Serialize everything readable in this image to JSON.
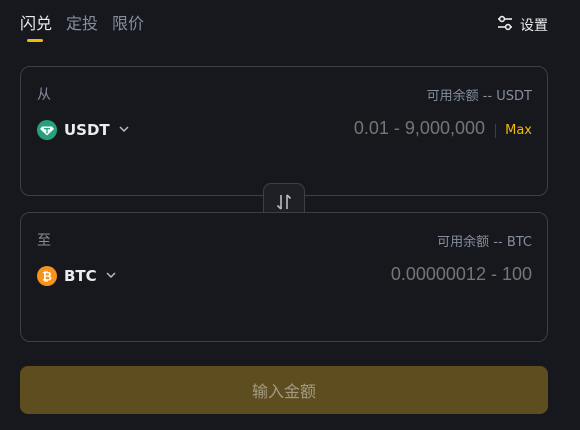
{
  "tabs": [
    {
      "label": "闪兑",
      "active": true
    },
    {
      "label": "定投",
      "active": false
    },
    {
      "label": "限价",
      "active": false
    }
  ],
  "settings": {
    "label": "设置",
    "icon": "sliders-icon"
  },
  "from": {
    "label": "从",
    "available": "可用余额 -- USDT",
    "asset": "USDT",
    "asset_icon": "usdt-coin-icon",
    "placeholder": "0.01 - 9,000,000",
    "max_label": "Max"
  },
  "to": {
    "label": "至",
    "available": "可用余额 -- BTC",
    "asset": "BTC",
    "asset_icon": "btc-coin-icon",
    "placeholder": "0.00000012 - 100"
  },
  "swap_icon": "swap-vertical-icon",
  "cta": {
    "label": "输入金额"
  },
  "colors": {
    "background": "#17181e",
    "accent": "#f0b90b",
    "usdt": "#26a17b",
    "btc": "#f7931a",
    "cta_bg": "#5e4d1f"
  }
}
